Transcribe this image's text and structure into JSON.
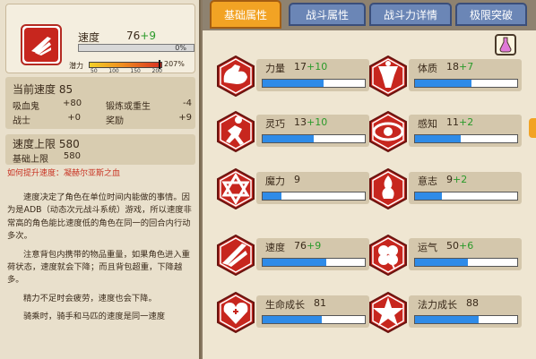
{
  "left": {
    "speed_label": "速度",
    "speed_value": "76",
    "speed_bonus": "+9",
    "speed_bar_pct": "0%",
    "potential_label": "潜力",
    "potential_ticks": [
      "50",
      "100",
      "150",
      "200"
    ],
    "potential_pct": "207%",
    "current_speed_title": "当前速度 85",
    "modifiers": [
      {
        "label": "吸血鬼",
        "value": "+80"
      },
      {
        "label": "锻炼或重生",
        "value": "-4"
      },
      {
        "label": "战士",
        "value": "+0"
      },
      {
        "label": "奖励",
        "value": "+9"
      }
    ],
    "cap_title": "速度上限 580",
    "cap_base_label": "基础上限",
    "cap_base_value": "580",
    "howto_label": "如何提升速度：",
    "howto_link": "凝赫尔亚斯之血",
    "description": [
      "速度决定了角色在单位时间内能做的事情。因为是ADB（动态次元战斗系统）游戏，所以速度非常高的角色能比速度低的角色在同一的回合内行动多次。",
      "注意背包内携带的物品重量，如果角色进入重荷状态，速度就会下降；而且背包超重，下降越多。",
      "精力不足时会疲劳，速度也会下降。",
      "骑乘时，骑手和马匹的速度是同一速度"
    ]
  },
  "tabs": [
    {
      "label": "基础属性",
      "active": true
    },
    {
      "label": "战斗属性",
      "active": false
    },
    {
      "label": "战斗力详情",
      "active": false
    },
    {
      "label": "极限突破",
      "active": false
    }
  ],
  "attributes": [
    {
      "name": "力量",
      "value": "17",
      "bonus": "+10",
      "fill": 0.6,
      "icon": "muscle-arm-icon"
    },
    {
      "name": "体质",
      "value": "18",
      "bonus": "+7",
      "fill": 0.55,
      "icon": "body-torso-icon"
    },
    {
      "name": "灵巧",
      "value": "13",
      "bonus": "+10",
      "fill": 0.5,
      "icon": "running-man-icon"
    },
    {
      "name": "感知",
      "value": "11",
      "bonus": "+2",
      "fill": 0.45,
      "icon": "eye-icon"
    },
    {
      "name": "魔力",
      "value": "9",
      "bonus": "",
      "fill": 0.18,
      "icon": "hexagram-icon"
    },
    {
      "name": "意志",
      "value": "9",
      "bonus": "+2",
      "fill": 0.26,
      "icon": "flame-head-icon"
    },
    {
      "name": "速度",
      "value": "76",
      "bonus": "+9",
      "fill": 0.62,
      "icon": "speed-wing-icon"
    },
    {
      "name": "运气",
      "value": "50",
      "bonus": "+6",
      "fill": 0.52,
      "icon": "clover-icon"
    },
    {
      "name": "生命成长",
      "value": "81",
      "bonus": "",
      "fill": 0.58,
      "icon": "heart-plus-icon"
    },
    {
      "name": "法力成长",
      "value": "88",
      "bonus": "",
      "fill": 0.62,
      "icon": "star-burst-icon"
    }
  ],
  "colors": {
    "emblem_red": "#c7261e",
    "bar_blue": "#2e8be8",
    "bonus_green": "#2a9a2a",
    "tab_active": "#f2a324",
    "tab_inactive": "#6b86b6"
  }
}
